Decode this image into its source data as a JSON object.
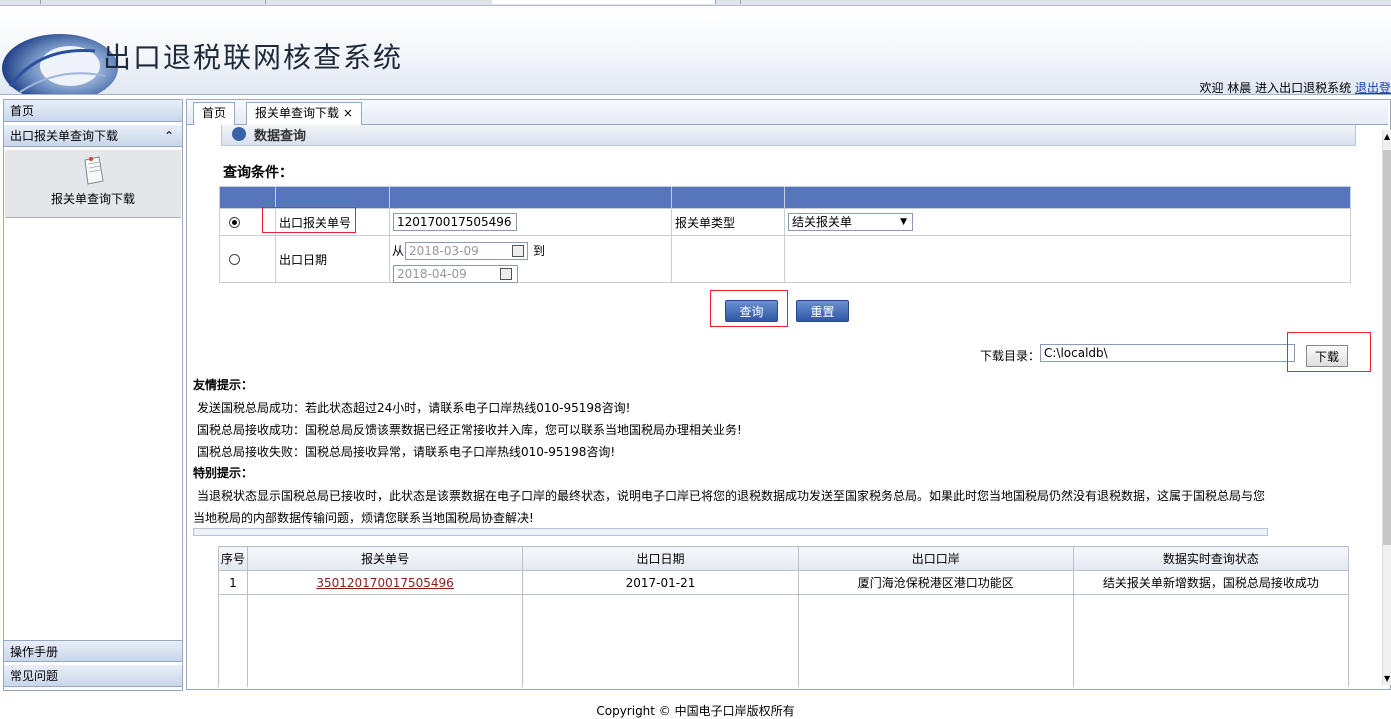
{
  "header": {
    "title": "出口退税联网核查系统",
    "welcome_prefix": "欢迎",
    "user": "林晨",
    "welcome_suffix": "进入出口退税系统",
    "logout": "退出登"
  },
  "sidebar": {
    "home": "首页",
    "section": "出口报关单查询下载",
    "collapse_icon": "⌃",
    "sub_item": "报关单查询下载",
    "manual": "操作手册",
    "faq": "常见问题"
  },
  "tabs": {
    "home": "首页",
    "active": "报关单查询下载",
    "close": "×"
  },
  "panel": {
    "header": "数据查询",
    "query_title": "查询条件："
  },
  "query": {
    "row1_label": "出口报关单号",
    "row1_value": "120170017505496",
    "type_label": "报关单类型",
    "type_value": "结关报关单",
    "row2_label": "出口日期",
    "from_label": "从",
    "from_placeholder": "2018-03-09",
    "to_label": "到",
    "to_placeholder": "2018-04-09"
  },
  "buttons": {
    "query": "查询",
    "reset": "重置",
    "download": "下载"
  },
  "download": {
    "label": "下载目录：",
    "path": "C:\\localdb\\"
  },
  "tips": {
    "friendly_title": "友情提示：",
    "line1": "发送国税总局成功：若此状态超过24小时，请联系电子口岸热线010-95198咨询!",
    "line2": "国税总局接收成功：国税总局反馈该票数据已经正常接收并入库，您可以联系当地国税局办理相关业务!",
    "line3": "国税总局接收失败：国税总局接收异常，请联系电子口岸热线010-95198咨询!",
    "special_title": "特别提示：",
    "special1": "当退税状态显示国税总局已接收时，此状态是该票数据在电子口岸的最终状态，说明电子口岸已将您的退税数据成功发送至国家税务总局。如果此时您当地国税局仍然没有退税数据，这属于国税总局与您",
    "special2": "当地税局的内部数据传输问题，烦请您联系当地国税局协查解决!"
  },
  "results": {
    "columns": [
      "序号",
      "报关单号",
      "出口日期",
      "出口口岸",
      "数据实时查询状态"
    ],
    "rows": [
      [
        "1",
        "350120170017505496",
        "2017-01-21",
        "厦门海沧保税港区港口功能区",
        "结关报关单新增数据，国税总局接收成功"
      ]
    ]
  },
  "footer": {
    "copyright": "Copyright © 中国电子口岸版权所有"
  },
  "colors": {
    "table_header": "#5775bd",
    "button": "#2e57a6",
    "highlight": "#e23333",
    "link": "#8b1a1a"
  }
}
